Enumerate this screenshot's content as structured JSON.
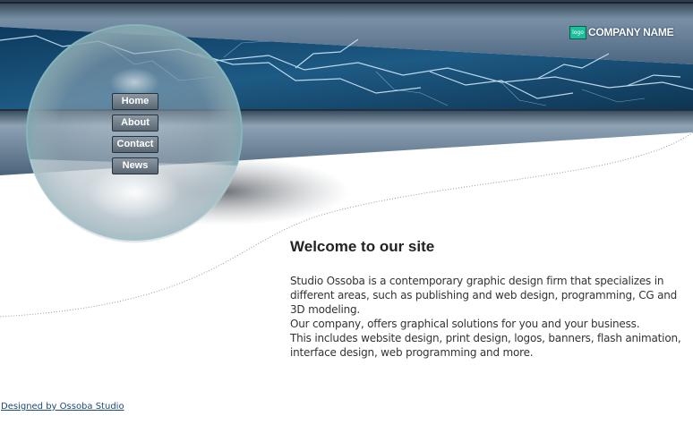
{
  "header": {
    "logo_text": "logo",
    "company_name": "COMPANY NAME"
  },
  "nav": {
    "items": [
      {
        "label": "Home"
      },
      {
        "label": "About"
      },
      {
        "label": "Contact"
      },
      {
        "label": "News"
      }
    ]
  },
  "main": {
    "title": "Welcome to our site",
    "paragraphs": [
      "Studio Ossoba is a contemporary graphic design firm that specializes in different areas, such as publishing and web design, programming, CG and 3D modeling.",
      "Our company, offers graphical solutions for you and your business.",
      "This includes website design, print design, logos, banners, flash animation, interface design, web programming and more."
    ]
  },
  "footer": {
    "credit": "Designed by Ossoba Studio"
  },
  "colors": {
    "banner_dark": "#1f4563",
    "steel": "#5e7991",
    "lightning": "#cfe6f8",
    "logo_green": "#1bbf9a"
  },
  "icons": {
    "sphere": "glass-sphere-icon",
    "lightning": "lightning-icon"
  }
}
